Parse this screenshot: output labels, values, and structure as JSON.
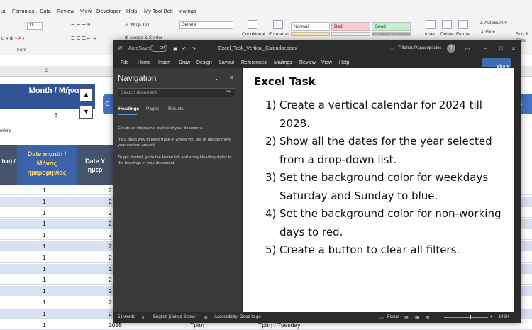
{
  "excel": {
    "menu": [
      "ut",
      "Formulas",
      "Data",
      "Review",
      "View",
      "Developer",
      "Help",
      "My Tool Belt",
      "xlwings"
    ],
    "ribbon": {
      "font_size": "11",
      "wrap_text": "Wrap Text",
      "merge_center": "Merge & Center",
      "number_format": "General",
      "conditional": "Conditional",
      "format_as": "Format as",
      "styles": {
        "normal": "Normal",
        "bad": "Bad",
        "good": "Good",
        "neutral": "Neutral",
        "calculation": "Calculation",
        "check_cell": "Check Cell"
      },
      "insert": "Insert",
      "delete": "Delete",
      "format": "Format",
      "autosum": "AutoSum",
      "fill": "Fill",
      "sort": "Sort &",
      "filter": "Filter",
      "group_font": "Font"
    },
    "col_c": "C",
    "month_header": "Month / Μήνας",
    "month_value": "6",
    "working_label": "orking",
    "col_a_header": "hat) /",
    "date_month_header": "Date month / Μήνας ημερομηνίας",
    "date_year_header": "Date Y\nημερ",
    "rows": [
      {
        "month": "1",
        "year": "2"
      },
      {
        "month": "1",
        "year": "2"
      },
      {
        "month": "1",
        "year": "2"
      },
      {
        "month": "1",
        "year": "2"
      },
      {
        "month": "1",
        "year": "2"
      },
      {
        "month": "1",
        "year": "2"
      },
      {
        "month": "1",
        "year": "2"
      },
      {
        "month": "1",
        "year": "2"
      },
      {
        "month": "1",
        "year": "2"
      },
      {
        "month": "1",
        "year": "2"
      },
      {
        "month": "1",
        "year": "2"
      },
      {
        "month": "1",
        "year": "2"
      }
    ],
    "last_row": {
      "month": "1",
      "year": "2025",
      "day_gr": "Τρίτη",
      "day_full": "Τρίτη / Tuesday"
    },
    "right_button": "ys"
  },
  "word": {
    "autosave": "AutoSave",
    "autosave_state": "Off",
    "filename": "Excel_Task_Vertical_Calendar.docx",
    "user": "Trifonas Papadopoulos",
    "user_initials": "TP",
    "menu": [
      "File",
      "Home",
      "Insert",
      "Draw",
      "Design",
      "Layout",
      "References",
      "Mailings",
      "Review",
      "View",
      "Help"
    ],
    "share": "Share",
    "nav": {
      "title": "Navigation",
      "search_placeholder": "Search document",
      "tabs": [
        "Headings",
        "Pages",
        "Results"
      ],
      "text1": "Create an interactive outline of your document.",
      "text2": "It's a great way to keep track of where you are or quickly move your content around.",
      "text3": "To get started, go to the Home tab and apply Heading styles to the headings in your document."
    },
    "doc": {
      "title": "Excel Task",
      "tasks": [
        {
          "n": "1)",
          "text": "Create a vertical calendar for 2024 till 2028."
        },
        {
          "n": "2)",
          "text": "Show all the dates for the year selected from a drop-down list."
        },
        {
          "n": "3)",
          "text": "Set the background color for weekdays Saturday and Sunday to blue."
        },
        {
          "n": "4)",
          "text": "Set the background color for non-working days to red."
        },
        {
          "n": "5)",
          "text": "Create a button to clear all filters."
        }
      ]
    },
    "status": {
      "words": "51 words",
      "language": "English (United States)",
      "accessibility": "Accessibility: Good to go",
      "focus": "Focus",
      "zoom": "148%"
    }
  },
  "colors": {
    "excel_header_blue": "#2f5597",
    "excel_header_slate": "#44546a",
    "excel_row_alt": "#d9e1f2",
    "word_dark": "#2b2b2b",
    "word_nav": "#3a3a3a",
    "accent": "#3c6fb4"
  }
}
